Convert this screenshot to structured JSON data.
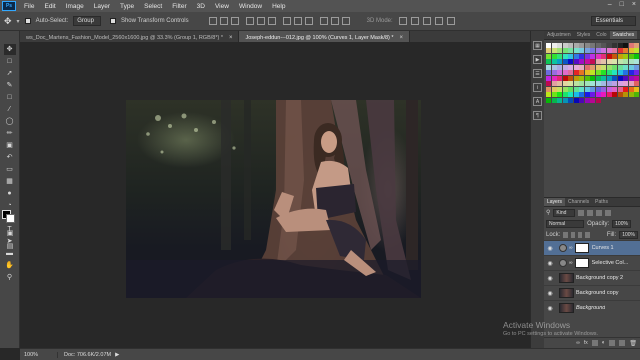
{
  "menu": {
    "logo": "Ps",
    "items": [
      "File",
      "Edit",
      "Image",
      "Layer",
      "Type",
      "Select",
      "Filter",
      "3D",
      "View",
      "Window",
      "Help"
    ]
  },
  "options_bar": {
    "auto_select_label": "Auto-Select:",
    "auto_select_value": "Group",
    "transform_label": "Show Transform Controls",
    "mode_3d_label": "3D Mode:",
    "workspace": "Essentials"
  },
  "document_tabs": [
    {
      "label": "ws_Doc_Martens_Fashion_Model_2560x1600.jpg @ 33.3% (Group 1, RGB/8*) *",
      "active": false
    },
    {
      "label": "Joseph-eddun---012.jpg @ 100% (Curves 1, Layer Mask/8) *",
      "active": true
    }
  ],
  "color_panel": {
    "tabs": [
      "Adjustmen",
      "Styles",
      "Colo",
      "Swatches"
    ],
    "active_tab": "Swatches"
  },
  "layers_panel": {
    "tabs": [
      "Layers",
      "Channels",
      "Paths"
    ],
    "kind_label": "Kind",
    "blend_mode": "Normal",
    "opacity_label": "Opacity:",
    "opacity_value": "100%",
    "lock_label": "Lock:",
    "fill_label": "Fill:",
    "fill_value": "100%",
    "layers": [
      {
        "name": "Curves 1",
        "selected": true
      },
      {
        "name": "Selective Col...",
        "selected": false
      },
      {
        "name": "Background copy 2",
        "selected": false
      },
      {
        "name": "Background copy",
        "selected": false
      },
      {
        "name": "Background",
        "selected": false
      }
    ]
  },
  "status_bar": {
    "zoom": "100%",
    "doc_info": "Doc: 706.6K/2.07M"
  },
  "watermark": {
    "line1": "Activate Windows",
    "line2": "Go to PC settings to activate Windows."
  },
  "colors": {
    "selected_layer": "#526f95",
    "panel_bg": "#474747",
    "canvas_bg": "#282828"
  }
}
